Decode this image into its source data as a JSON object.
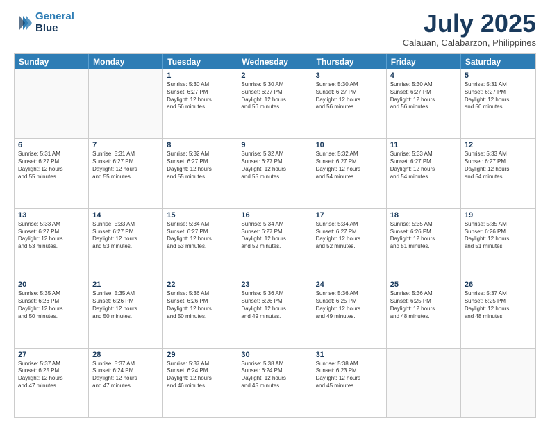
{
  "header": {
    "logo_line1": "General",
    "logo_line2": "Blue",
    "month": "July 2025",
    "location": "Calauan, Calabarzon, Philippines"
  },
  "days_of_week": [
    "Sunday",
    "Monday",
    "Tuesday",
    "Wednesday",
    "Thursday",
    "Friday",
    "Saturday"
  ],
  "weeks": [
    [
      {
        "day": "",
        "info": ""
      },
      {
        "day": "",
        "info": ""
      },
      {
        "day": "1",
        "info": "Sunrise: 5:30 AM\nSunset: 6:27 PM\nDaylight: 12 hours\nand 56 minutes."
      },
      {
        "day": "2",
        "info": "Sunrise: 5:30 AM\nSunset: 6:27 PM\nDaylight: 12 hours\nand 56 minutes."
      },
      {
        "day": "3",
        "info": "Sunrise: 5:30 AM\nSunset: 6:27 PM\nDaylight: 12 hours\nand 56 minutes."
      },
      {
        "day": "4",
        "info": "Sunrise: 5:30 AM\nSunset: 6:27 PM\nDaylight: 12 hours\nand 56 minutes."
      },
      {
        "day": "5",
        "info": "Sunrise: 5:31 AM\nSunset: 6:27 PM\nDaylight: 12 hours\nand 56 minutes."
      }
    ],
    [
      {
        "day": "6",
        "info": "Sunrise: 5:31 AM\nSunset: 6:27 PM\nDaylight: 12 hours\nand 55 minutes."
      },
      {
        "day": "7",
        "info": "Sunrise: 5:31 AM\nSunset: 6:27 PM\nDaylight: 12 hours\nand 55 minutes."
      },
      {
        "day": "8",
        "info": "Sunrise: 5:32 AM\nSunset: 6:27 PM\nDaylight: 12 hours\nand 55 minutes."
      },
      {
        "day": "9",
        "info": "Sunrise: 5:32 AM\nSunset: 6:27 PM\nDaylight: 12 hours\nand 55 minutes."
      },
      {
        "day": "10",
        "info": "Sunrise: 5:32 AM\nSunset: 6:27 PM\nDaylight: 12 hours\nand 54 minutes."
      },
      {
        "day": "11",
        "info": "Sunrise: 5:33 AM\nSunset: 6:27 PM\nDaylight: 12 hours\nand 54 minutes."
      },
      {
        "day": "12",
        "info": "Sunrise: 5:33 AM\nSunset: 6:27 PM\nDaylight: 12 hours\nand 54 minutes."
      }
    ],
    [
      {
        "day": "13",
        "info": "Sunrise: 5:33 AM\nSunset: 6:27 PM\nDaylight: 12 hours\nand 53 minutes."
      },
      {
        "day": "14",
        "info": "Sunrise: 5:33 AM\nSunset: 6:27 PM\nDaylight: 12 hours\nand 53 minutes."
      },
      {
        "day": "15",
        "info": "Sunrise: 5:34 AM\nSunset: 6:27 PM\nDaylight: 12 hours\nand 53 minutes."
      },
      {
        "day": "16",
        "info": "Sunrise: 5:34 AM\nSunset: 6:27 PM\nDaylight: 12 hours\nand 52 minutes."
      },
      {
        "day": "17",
        "info": "Sunrise: 5:34 AM\nSunset: 6:27 PM\nDaylight: 12 hours\nand 52 minutes."
      },
      {
        "day": "18",
        "info": "Sunrise: 5:35 AM\nSunset: 6:26 PM\nDaylight: 12 hours\nand 51 minutes."
      },
      {
        "day": "19",
        "info": "Sunrise: 5:35 AM\nSunset: 6:26 PM\nDaylight: 12 hours\nand 51 minutes."
      }
    ],
    [
      {
        "day": "20",
        "info": "Sunrise: 5:35 AM\nSunset: 6:26 PM\nDaylight: 12 hours\nand 50 minutes."
      },
      {
        "day": "21",
        "info": "Sunrise: 5:35 AM\nSunset: 6:26 PM\nDaylight: 12 hours\nand 50 minutes."
      },
      {
        "day": "22",
        "info": "Sunrise: 5:36 AM\nSunset: 6:26 PM\nDaylight: 12 hours\nand 50 minutes."
      },
      {
        "day": "23",
        "info": "Sunrise: 5:36 AM\nSunset: 6:26 PM\nDaylight: 12 hours\nand 49 minutes."
      },
      {
        "day": "24",
        "info": "Sunrise: 5:36 AM\nSunset: 6:25 PM\nDaylight: 12 hours\nand 49 minutes."
      },
      {
        "day": "25",
        "info": "Sunrise: 5:36 AM\nSunset: 6:25 PM\nDaylight: 12 hours\nand 48 minutes."
      },
      {
        "day": "26",
        "info": "Sunrise: 5:37 AM\nSunset: 6:25 PM\nDaylight: 12 hours\nand 48 minutes."
      }
    ],
    [
      {
        "day": "27",
        "info": "Sunrise: 5:37 AM\nSunset: 6:25 PM\nDaylight: 12 hours\nand 47 minutes."
      },
      {
        "day": "28",
        "info": "Sunrise: 5:37 AM\nSunset: 6:24 PM\nDaylight: 12 hours\nand 47 minutes."
      },
      {
        "day": "29",
        "info": "Sunrise: 5:37 AM\nSunset: 6:24 PM\nDaylight: 12 hours\nand 46 minutes."
      },
      {
        "day": "30",
        "info": "Sunrise: 5:38 AM\nSunset: 6:24 PM\nDaylight: 12 hours\nand 45 minutes."
      },
      {
        "day": "31",
        "info": "Sunrise: 5:38 AM\nSunset: 6:23 PM\nDaylight: 12 hours\nand 45 minutes."
      },
      {
        "day": "",
        "info": ""
      },
      {
        "day": "",
        "info": ""
      }
    ]
  ]
}
